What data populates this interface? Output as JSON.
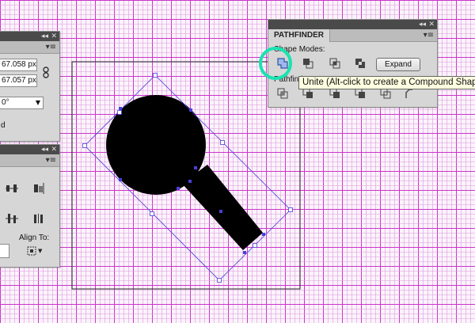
{
  "colors": {
    "grid_fine": "#dc9adc",
    "grid_major": "#cc33cc",
    "artboard_border": "#222222",
    "selection": "#4b3fd8",
    "highlight_ring": "#19e3b0",
    "shape_fill": "#000000"
  },
  "left_panel_top": {
    "width_value": "67.058 px",
    "height_value": "67.057 px",
    "link_icon": "chain-link-icon",
    "angle_value": "0°",
    "partial_label": "d"
  },
  "align_panel": {
    "align_to_label": "Align To:",
    "align_to_icon": "align-to-selection-icon"
  },
  "pathfinder": {
    "title": "PATHFINDER",
    "shape_modes_label": "Shape Modes:",
    "pathfinders_label": "Pathfinders:",
    "expand_label": "Expand",
    "shape_mode_icons": [
      "unite-icon",
      "minus-front-icon",
      "intersect-icon",
      "exclude-icon"
    ],
    "pathfinder_icons": [
      "divide-icon",
      "trim-icon",
      "merge-icon",
      "crop-icon",
      "outline-icon",
      "minus-back-icon"
    ]
  },
  "tooltip": {
    "text": "Unite (Alt-click to create a Compound Shape"
  }
}
